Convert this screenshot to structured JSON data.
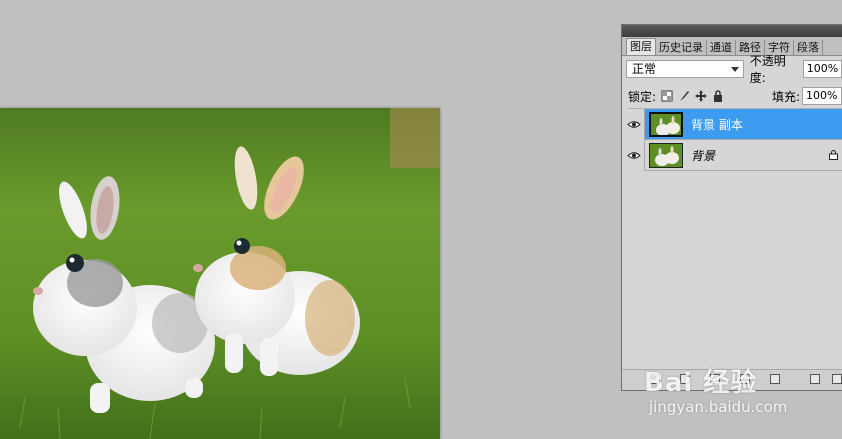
{
  "layers_panel": {
    "tabs": [
      {
        "label": "图层"
      },
      {
        "label": "历史记录"
      },
      {
        "label": "通道"
      },
      {
        "label": "路径"
      },
      {
        "label": "字符"
      },
      {
        "label": "段落"
      }
    ],
    "blend_mode": "正常",
    "opacity_label": "不透明度:",
    "opacity_value": "100%",
    "lock_label": "锁定:",
    "fill_label": "填充:",
    "fill_value": "100%",
    "layers": [
      {
        "name": "背景 副本",
        "selected": true
      },
      {
        "name": "背景",
        "selected": false,
        "locked": true
      }
    ]
  },
  "watermark": {
    "logo": "Bai 经验",
    "url": "jingyan.baidu.com"
  },
  "colors": {
    "selection": "#3d9cf0",
    "workspace": "#c0c0c0"
  }
}
